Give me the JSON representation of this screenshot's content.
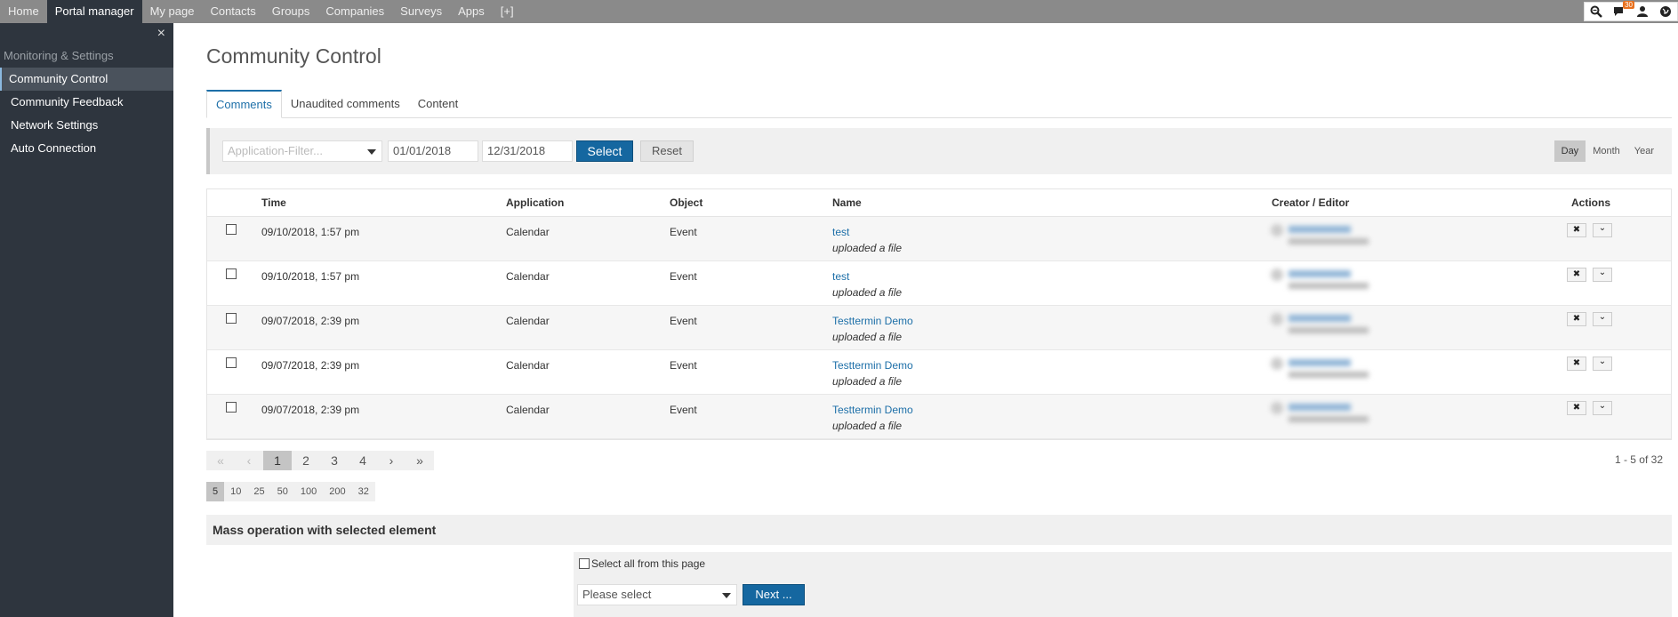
{
  "topnav": {
    "items": [
      "Home",
      "Portal manager",
      "My page",
      "Contacts",
      "Groups",
      "Companies",
      "Surveys",
      "Apps",
      "[+]"
    ],
    "active_index": 1,
    "notification_count": "30"
  },
  "sidebar": {
    "close_glyph": "×",
    "section_title": "Monitoring & Settings",
    "items": [
      "Community Control",
      "Community Feedback",
      "Network Settings",
      "Auto Connection"
    ],
    "active_index": 0
  },
  "page": {
    "title": "Community Control",
    "tabs": [
      "Comments",
      "Unaudited comments",
      "Content"
    ],
    "active_tab": 0
  },
  "filter": {
    "app_placeholder": "Application-Filter...",
    "date_from": "01/01/2018",
    "date_to": "12/31/2018",
    "select_label": "Select",
    "reset_label": "Reset",
    "periods": [
      "Day",
      "Month",
      "Year"
    ],
    "active_period": 0
  },
  "table": {
    "headers": [
      "Time",
      "Application",
      "Object",
      "Name",
      "Creator / Editor",
      "Actions"
    ],
    "rows": [
      {
        "time": "09/10/2018, 1:57 pm",
        "application": "Calendar",
        "object": "Event",
        "name": "test",
        "sub": "uploaded a file"
      },
      {
        "time": "09/10/2018, 1:57 pm",
        "application": "Calendar",
        "object": "Event",
        "name": "test",
        "sub": "uploaded a file"
      },
      {
        "time": "09/07/2018, 2:39 pm",
        "application": "Calendar",
        "object": "Event",
        "name": "Testtermin Demo",
        "sub": "uploaded a file"
      },
      {
        "time": "09/07/2018, 2:39 pm",
        "application": "Calendar",
        "object": "Event",
        "name": "Testtermin Demo",
        "sub": "uploaded a file"
      },
      {
        "time": "09/07/2018, 2:39 pm",
        "application": "Calendar",
        "object": "Event",
        "name": "Testtermin Demo",
        "sub": "uploaded a file"
      }
    ],
    "delete_glyph": "✖",
    "expand_glyph": "⌄"
  },
  "pagination": {
    "first": "«",
    "prev": "‹",
    "pages": [
      "1",
      "2",
      "3",
      "4"
    ],
    "active_page": 0,
    "next": "›",
    "last": "»",
    "summary": "1 - 5 of 32",
    "page_sizes": [
      "5",
      "10",
      "25",
      "50",
      "100",
      "200",
      "32"
    ],
    "active_size": 0
  },
  "mass": {
    "title": "Mass operation with selected element",
    "select_all_label": "Select all from this page",
    "dropdown_placeholder": "Please select",
    "next_label": "Next ..."
  },
  "colors": {
    "accent": "#1567a0",
    "sidebar_bg": "#2e353e",
    "topnav_bg": "#8a8a8a",
    "badge": "#e8711e"
  }
}
